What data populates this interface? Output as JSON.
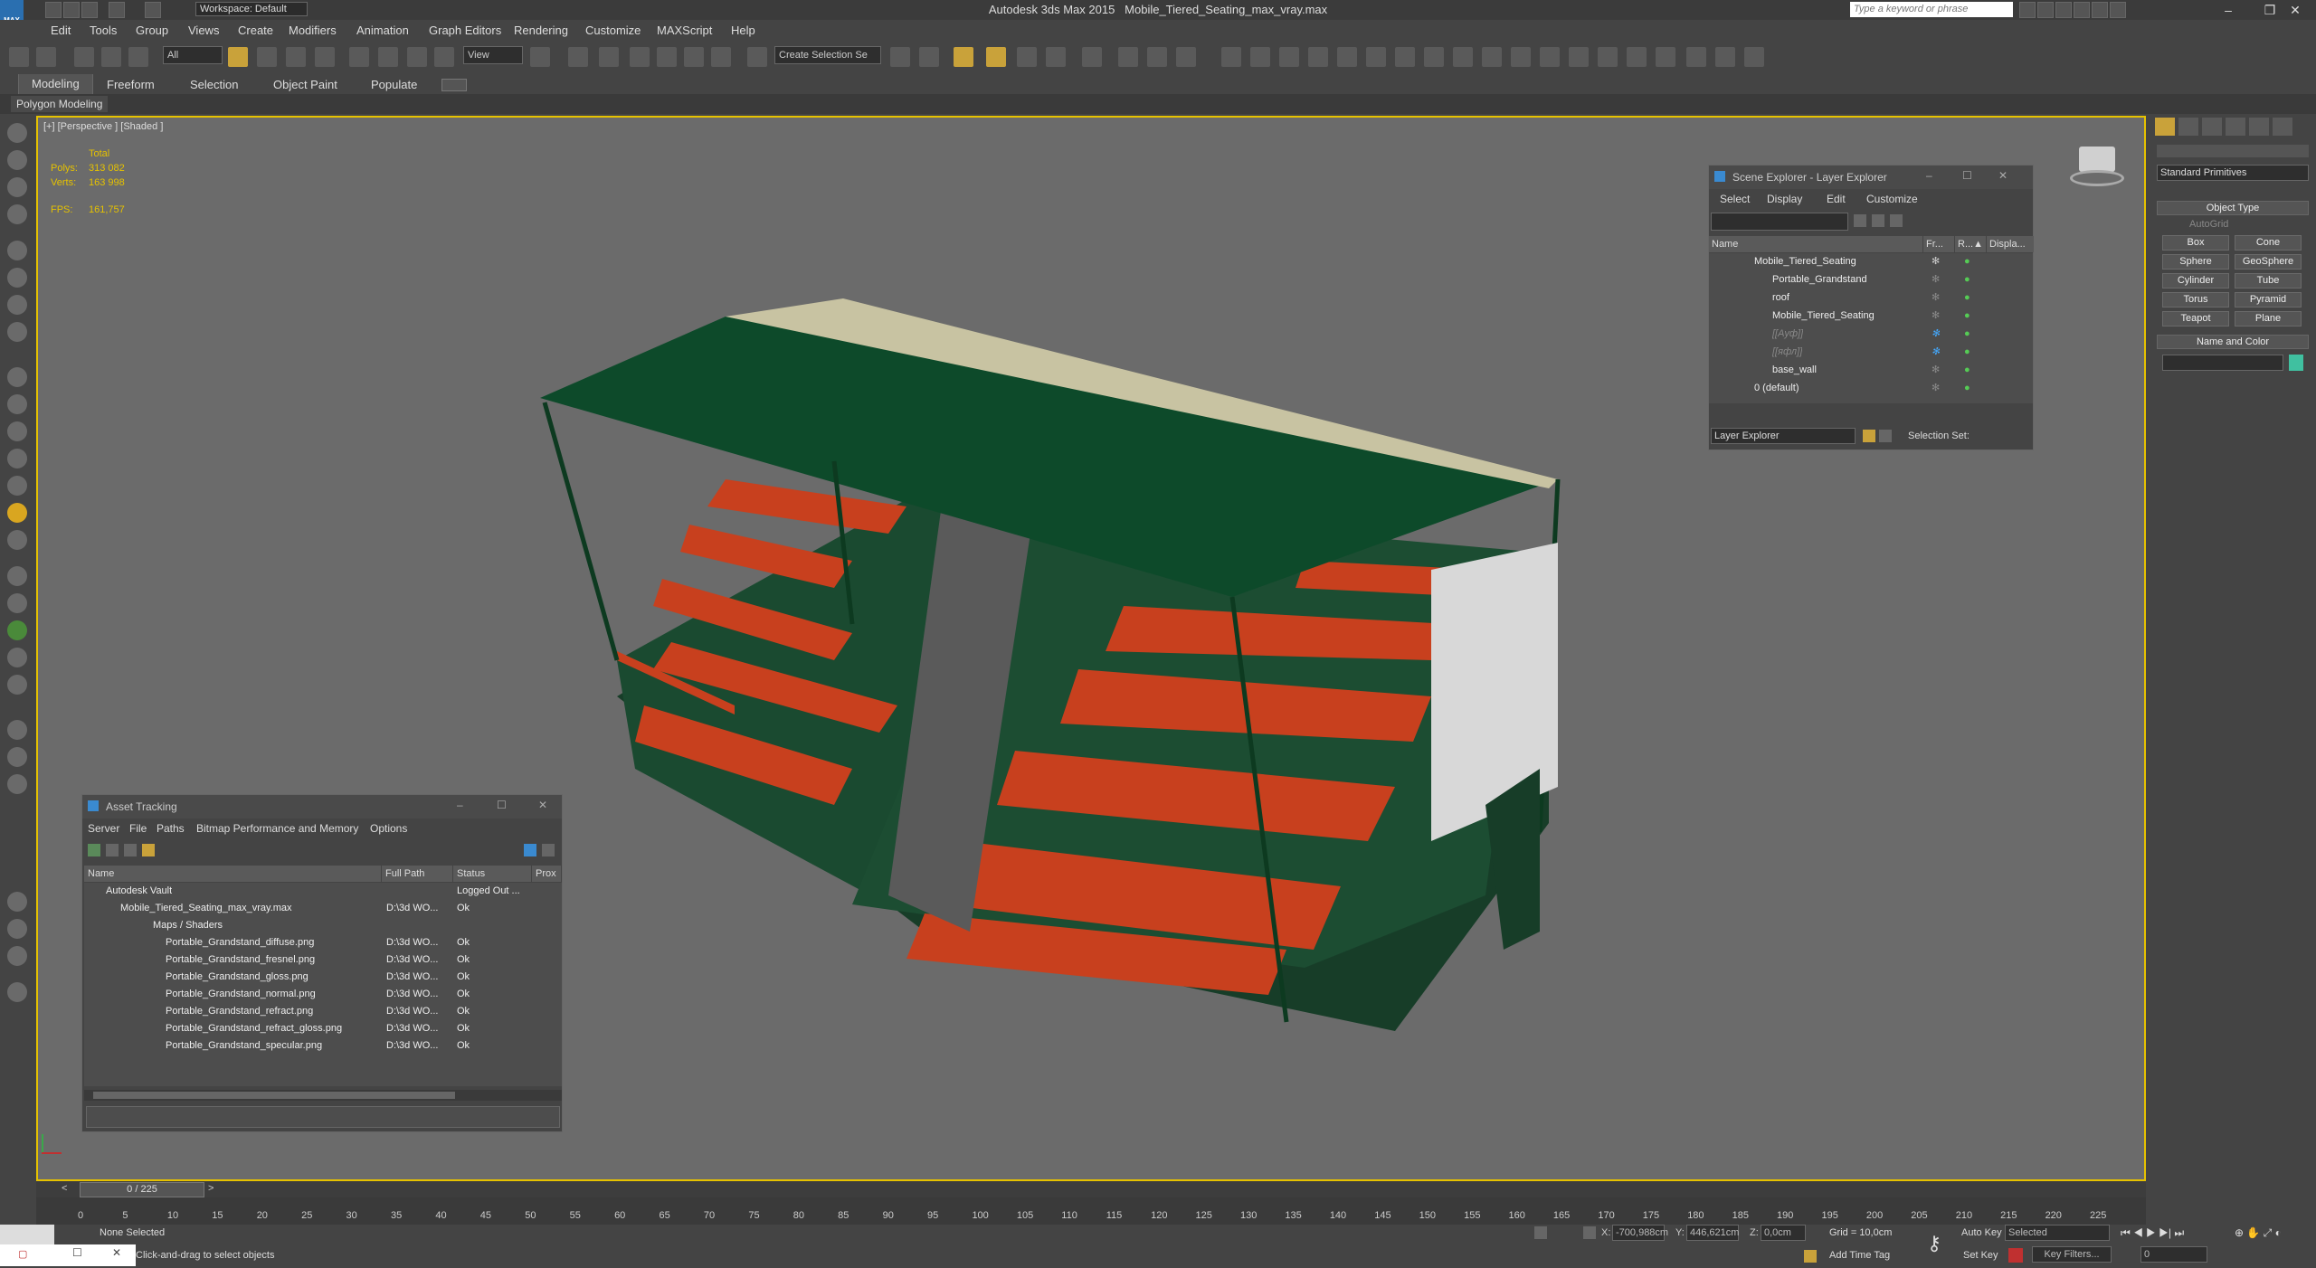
{
  "titlebar": {
    "app": "Autodesk 3ds Max  2015",
    "file": "Mobile_Tiered_Seating_max_vray.max",
    "workspace": "Workspace: Default",
    "search_placeholder": "Type a keyword or phrase",
    "logo": "MAX"
  },
  "menu": [
    "Edit",
    "Tools",
    "Group",
    "Views",
    "Create",
    "Modifiers",
    "Animation",
    "Graph Editors",
    "Rendering",
    "Customize",
    "MAXScript",
    "Help"
  ],
  "toolbar": {
    "selection_filter": "All",
    "ref_coord": "View",
    "named_selection": "Create Selection Se"
  },
  "ribbon": {
    "tabs": [
      "Modeling",
      "Freeform",
      "Selection",
      "Object Paint",
      "Populate"
    ],
    "subtab": "Polygon Modeling"
  },
  "viewport": {
    "label": "[+] [Perspective ] [Shaded ]",
    "stats": {
      "total_label": "Total",
      "polys_label": "Polys:",
      "polys": "313 082",
      "verts_label": "Verts:",
      "verts": "163 998",
      "fps_label": "FPS:",
      "fps": "161,757"
    }
  },
  "scene_explorer": {
    "title": "Scene Explorer - Layer Explorer",
    "menu": [
      "Select",
      "Display",
      "Edit",
      "Customize"
    ],
    "columns": [
      "Name",
      "Fr...",
      "R...▲",
      "Displa..."
    ],
    "rows": [
      {
        "name": "Mobile_Tiered_Seating",
        "indent": 0
      },
      {
        "name": "Portable_Grandstand",
        "indent": 1
      },
      {
        "name": "roof",
        "indent": 1
      },
      {
        "name": "Mobile_Tiered_Seating",
        "indent": 1
      },
      {
        "name": "[[Ауф]]",
        "indent": 1
      },
      {
        "name": "[[яфл]]",
        "indent": 1
      },
      {
        "name": "base_wall",
        "indent": 1
      },
      {
        "name": "0 (default)",
        "indent": 0
      }
    ],
    "footer_dropdown": "Layer Explorer",
    "selection_set_label": "Selection Set:"
  },
  "asset_tracking": {
    "title": "Asset Tracking",
    "menu": [
      "Server",
      "File",
      "Paths",
      "Bitmap Performance and Memory",
      "Options"
    ],
    "columns": [
      "Name",
      "Full Path",
      "Status",
      "Prox"
    ],
    "rows": [
      {
        "name": "Autodesk Vault",
        "path": "",
        "status": "Logged Out ...",
        "indent": 1
      },
      {
        "name": "Mobile_Tiered_Seating_max_vray.max",
        "path": "D:\\3d WO...",
        "status": "Ok",
        "indent": 2
      },
      {
        "name": "Maps / Shaders",
        "path": "",
        "status": "",
        "indent": 3
      },
      {
        "name": "Portable_Grandstand_diffuse.png",
        "path": "D:\\3d WO...",
        "status": "Ok",
        "indent": 4
      },
      {
        "name": "Portable_Grandstand_fresnel.png",
        "path": "D:\\3d WO...",
        "status": "Ok",
        "indent": 4
      },
      {
        "name": "Portable_Grandstand_gloss.png",
        "path": "D:\\3d WO...",
        "status": "Ok",
        "indent": 4
      },
      {
        "name": "Portable_Grandstand_normal.png",
        "path": "D:\\3d WO...",
        "status": "Ok",
        "indent": 4
      },
      {
        "name": "Portable_Grandstand_refract.png",
        "path": "D:\\3d WO...",
        "status": "Ok",
        "indent": 4
      },
      {
        "name": "Portable_Grandstand_refract_gloss.png",
        "path": "D:\\3d WO...",
        "status": "Ok",
        "indent": 4
      },
      {
        "name": "Portable_Grandstand_specular.png",
        "path": "D:\\3d WO...",
        "status": "Ok",
        "indent": 4
      }
    ]
  },
  "command_panel": {
    "category": "Standard Primitives",
    "object_type_label": "Object Type",
    "autogrid_label": "AutoGrid",
    "buttons": [
      "Box",
      "Cone",
      "Sphere",
      "GeoSphere",
      "Cylinder",
      "Tube",
      "Torus",
      "Pyramid",
      "Teapot",
      "Plane"
    ],
    "name_color_label": "Name and Color",
    "swatch_color": "#40c0a0"
  },
  "timeline": {
    "slider": "0 / 225",
    "ticks": [
      "0",
      "5",
      "10",
      "15",
      "20",
      "25",
      "30",
      "35",
      "40",
      "45",
      "50",
      "55",
      "60",
      "65",
      "70",
      "75",
      "80",
      "85",
      "90",
      "95",
      "100",
      "105",
      "110",
      "115",
      "120",
      "125",
      "130",
      "135",
      "140",
      "145",
      "150",
      "155",
      "160",
      "165",
      "170",
      "175",
      "180",
      "185",
      "190",
      "195",
      "200",
      "205",
      "210",
      "215",
      "220",
      "225"
    ]
  },
  "status": {
    "selection": "None Selected",
    "prompt": "Click-and-drag to select objects",
    "x_label": "X:",
    "x": "-700,988cm",
    "y_label": "Y:",
    "y": "446,621cm",
    "z_label": "Z:",
    "z": "0,0cm",
    "grid": "Grid = 10,0cm",
    "auto_key": "Auto Key",
    "selected": "Selected",
    "set_key": "Set Key",
    "key_filters": "Key Filters...",
    "add_time_tag": "Add Time Tag",
    "frame": "0"
  },
  "colors": {
    "roof_green": "#0d4a2a",
    "seat_red": "#c8401e",
    "roof_beige": "#c8c3a2",
    "accent": "#e6c200"
  }
}
